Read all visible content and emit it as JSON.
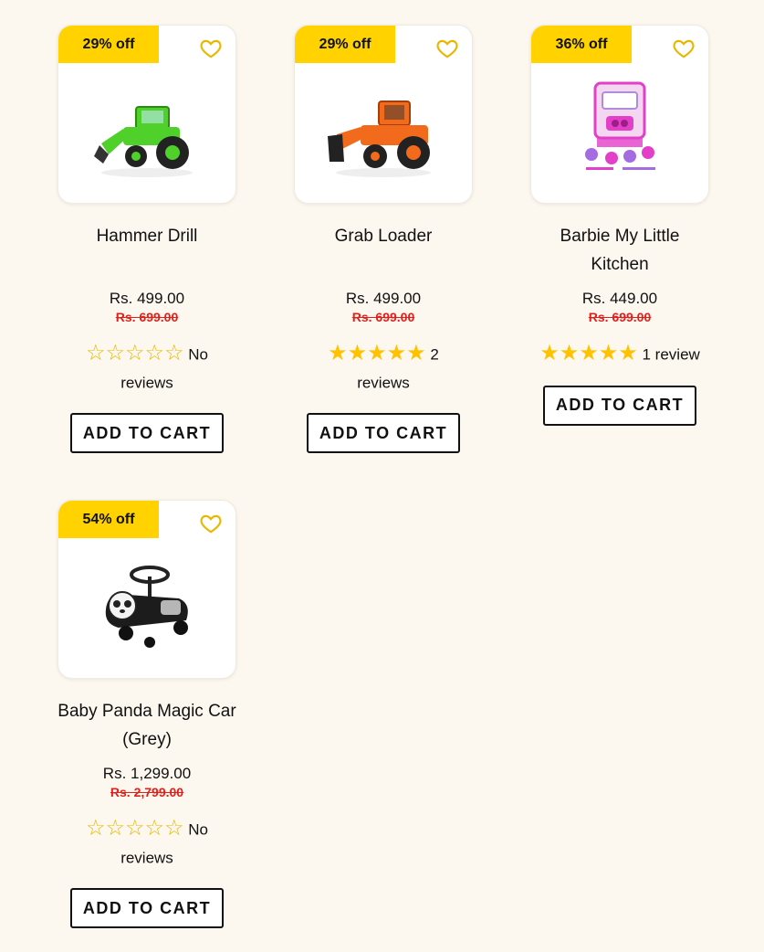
{
  "products": [
    {
      "badge": "29% off",
      "title": "Hammer Drill",
      "price": "Rs. 499.00",
      "old_price": "Rs. 699.00",
      "rating_stars": 0,
      "reviews": "No reviews",
      "cart_label": "ADD TO CART",
      "art_color": "#4fd02a"
    },
    {
      "badge": "29% off",
      "title": "Grab Loader",
      "price": "Rs. 499.00",
      "old_price": "Rs. 699.00",
      "rating_stars": 5,
      "reviews": "2 reviews",
      "cart_label": "ADD TO CART",
      "art_color": "#f26a1b"
    },
    {
      "badge": "36% off",
      "title": "Barbie My Little Kitchen",
      "price": "Rs. 449.00",
      "old_price": "Rs. 699.00",
      "rating_stars": 5,
      "reviews": "1 review",
      "cart_label": "ADD TO CART",
      "art_color": "#e43fc8"
    },
    {
      "badge": "54% off",
      "title": "Baby Panda Magic Car (Grey)",
      "price": "Rs. 1,299.00",
      "old_price": "Rs. 2,799.00",
      "rating_stars": 0,
      "reviews": "No reviews",
      "cart_label": "ADD TO CART",
      "art_color": "#222222"
    }
  ],
  "colors": {
    "background": "#fdf8ef",
    "badge": "#ffd200",
    "old_price": "#e0201b",
    "star": "#ffc200"
  }
}
